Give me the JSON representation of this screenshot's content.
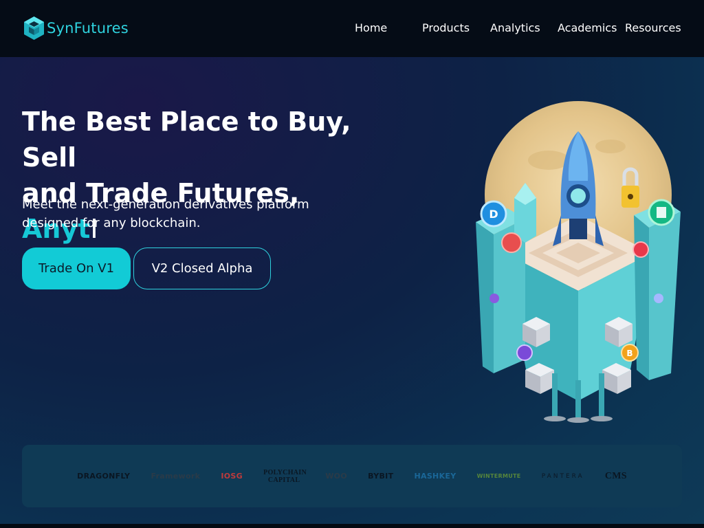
{
  "brand": {
    "name": "SynFutures"
  },
  "nav": {
    "items": [
      {
        "label": "Home"
      },
      {
        "label": "Products"
      },
      {
        "label": "Analytics"
      },
      {
        "label": "Academics"
      },
      {
        "label": "Resources"
      }
    ]
  },
  "hero": {
    "headline_line1": "The Best Place to Buy, Sell",
    "headline_line2_prefix": "and Trade Futures,",
    "headline_typed": "Anyt",
    "headline_cursor": "I",
    "subtitle": "Meet the next-generation derivatives platform designed for any blockchain.",
    "primary_button": "Trade On V1",
    "secondary_button": "V2 Closed Alpha"
  },
  "partners": [
    {
      "name": "DRAGONFLY"
    },
    {
      "name": "Framework"
    },
    {
      "name": "IOSG"
    },
    {
      "name": "POLYCHAIN CAPITAL"
    },
    {
      "name": "WOO"
    },
    {
      "name": "BYBIT"
    },
    {
      "name": "HASHKEY"
    },
    {
      "name": "WINTERMUTE"
    },
    {
      "name": "PANTERA"
    },
    {
      "name": "CMS"
    }
  ],
  "colors": {
    "accent": "#16c8d6",
    "navbar_bg": "#050c16",
    "partners_bg": "#0f3a55"
  }
}
